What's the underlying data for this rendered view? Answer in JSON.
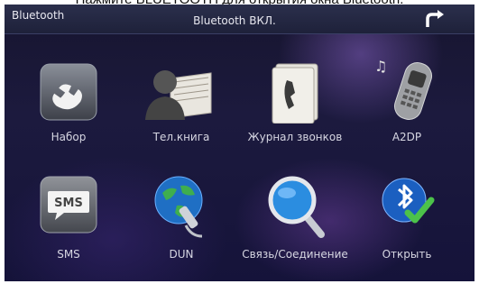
{
  "caption": "Нажмите BLUETOOTH для открытия окна Bluetooth.",
  "header": {
    "app_name": "Bluetooth",
    "status": "Bluetooth ВКЛ."
  },
  "tiles": [
    {
      "label": "Набор",
      "icon": "phone-handset-icon"
    },
    {
      "label": "Тел.книга",
      "icon": "phonebook-icon"
    },
    {
      "label": "Журнал звонков",
      "icon": "call-log-icon"
    },
    {
      "label": "A2DP",
      "icon": "music-phone-icon"
    },
    {
      "label": "SMS",
      "icon": "sms-icon"
    },
    {
      "label": "DUN",
      "icon": "globe-network-icon"
    },
    {
      "label": "Связь/Соединение",
      "icon": "magnifier-icon"
    },
    {
      "label": "Открыть",
      "icon": "bluetooth-check-icon"
    }
  ],
  "colors": {
    "background": "#1c1a3e",
    "titlebar": "#2b2f4c",
    "text": "#d6d6e2"
  }
}
